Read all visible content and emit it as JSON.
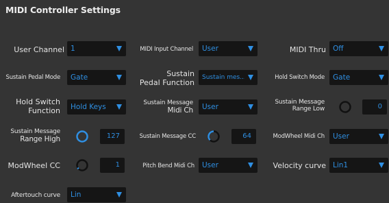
{
  "panel": {
    "title": "MIDI Controller Settings"
  },
  "colors": {
    "accent": "#2f8fe2",
    "background": "#343434",
    "control_bg": "#151515",
    "text": "#e4e4e4"
  },
  "settings": {
    "user_channel": {
      "label": "User Channel",
      "value": "1"
    },
    "midi_input_channel": {
      "label": "MIDI Input Channel",
      "value": "User"
    },
    "midi_thru": {
      "label": "MIDI Thru",
      "value": "Off"
    },
    "sustain_pedal_mode": {
      "label": "Sustain Pedal Mode",
      "value": "Gate"
    },
    "sustain_pedal_function": {
      "label_line1": "Sustain",
      "label_line2": "Pedal Function",
      "value": "Sustain mes..."
    },
    "hold_switch_mode": {
      "label": "Hold Switch Mode",
      "value": "Gate"
    },
    "hold_switch_function": {
      "label_line1": "Hold Switch",
      "label_line2": "Function",
      "value": "Hold Keys"
    },
    "sustain_message_midi_ch": {
      "label_line1": "Sustain Message",
      "label_line2": "Midi Ch",
      "value": "User"
    },
    "sustain_message_range_low": {
      "label_line1": "Sustain Message",
      "label_line2": "Range Low",
      "value": "0",
      "knob_icon": "knob-icon"
    },
    "sustain_message_range_high": {
      "label_line1": "Sustain Message",
      "label_line2": "Range High",
      "value": "127",
      "knob_icon": "knob-icon"
    },
    "sustain_message_cc": {
      "label": "Sustain Message CC",
      "value": "64",
      "knob_icon": "knob-icon"
    },
    "modwheel_midi_ch": {
      "label": "ModWheel Midi Ch",
      "value": "User"
    },
    "modwheel_cc": {
      "label": "ModWheel CC",
      "value": "1",
      "knob_icon": "knob-icon"
    },
    "pitch_bend_midi_ch": {
      "label": "Pitch Bend Midi Ch",
      "value": "User"
    },
    "velocity_curve": {
      "label": "Velocity curve",
      "value": "Lin1"
    },
    "aftertouch_curve": {
      "label": "Aftertouch curve",
      "value": "Lin"
    }
  }
}
